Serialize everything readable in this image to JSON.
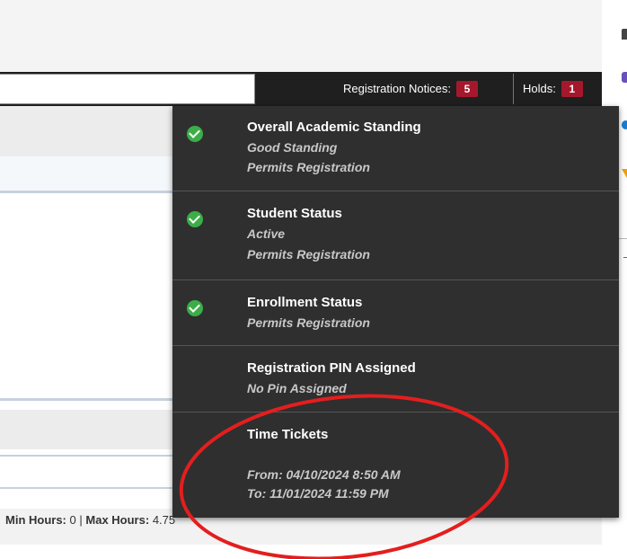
{
  "header": {
    "registration_notices_label": "Registration Notices:",
    "registration_notices_count": "5",
    "holds_label": "Holds:",
    "holds_count": "1"
  },
  "notices": [
    {
      "title": "Overall Academic Standing",
      "lines": [
        "Good Standing",
        "Permits Registration"
      ],
      "checked": true
    },
    {
      "title": "Student Status",
      "lines": [
        "Active",
        "Permits Registration"
      ],
      "checked": true
    },
    {
      "title": "Enrollment Status",
      "lines": [
        "Permits Registration"
      ],
      "checked": true
    },
    {
      "title": "Registration PIN Assigned",
      "lines": [
        "No Pin Assigned"
      ],
      "checked": false
    },
    {
      "title": "Time Tickets",
      "lines": [
        "From: 04/10/2024 8:50 AM",
        "To: 11/01/2024 11:59 PM"
      ],
      "checked": false
    }
  ],
  "hours": {
    "min_label": "Min Hours:",
    "min_value": "0",
    "separator": "|",
    "max_label": "Max Hours:",
    "max_value": "4.75"
  },
  "colors": {
    "badge": "#a5182c",
    "check": "#3cae48",
    "dropdown_bg": "#2f2f2f",
    "annotation": "#e41e1e"
  }
}
